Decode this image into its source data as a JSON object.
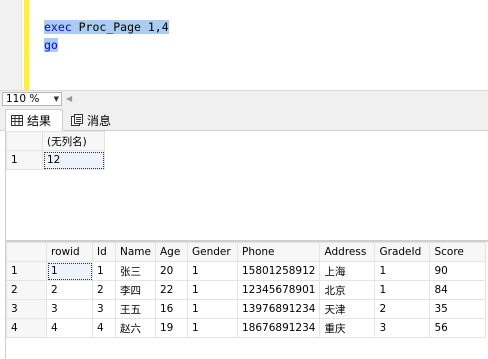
{
  "editor": {
    "lines": [
      {
        "keyword": "exec",
        "rest": " Proc_Page 1,4"
      },
      {
        "keyword": "go",
        "rest": ""
      }
    ]
  },
  "status": {
    "zoom": "110 %",
    "zoom_arrow_icon": "chevron-down-icon",
    "scroll_left_icon": "triangle-left-icon"
  },
  "tabs": [
    {
      "label": "结果",
      "icon": "grid-icon",
      "active": true
    },
    {
      "label": "消息",
      "icon": "messages-icon",
      "active": false
    }
  ],
  "result1": {
    "columns": [
      "(无列名)"
    ],
    "rows": [
      {
        "n": "1",
        "cells": [
          "12"
        ]
      }
    ]
  },
  "result2": {
    "columns": [
      "rowid",
      "Id",
      "Name",
      "Age",
      "Gender",
      "Phone",
      "Address",
      "GradeId",
      "Score"
    ],
    "rows": [
      {
        "n": "1",
        "cells": [
          "1",
          "1",
          "张三",
          "20",
          "1",
          "15801258912",
          "上海",
          "1",
          "90"
        ]
      },
      {
        "n": "2",
        "cells": [
          "2",
          "2",
          "李四",
          "22",
          "1",
          "12345678901",
          "北京",
          "1",
          "84"
        ]
      },
      {
        "n": "3",
        "cells": [
          "3",
          "3",
          "王五",
          "16",
          "1",
          "13976891234",
          "天津",
          "2",
          "35"
        ]
      },
      {
        "n": "4",
        "cells": [
          "4",
          "4",
          "赵六",
          "19",
          "1",
          "18676891234",
          "重庆",
          "3",
          "56"
        ]
      }
    ]
  },
  "colors": {
    "selection": "#a9ccf0",
    "keyword": "#0000ff",
    "margin_bar": "#ffed4a"
  }
}
